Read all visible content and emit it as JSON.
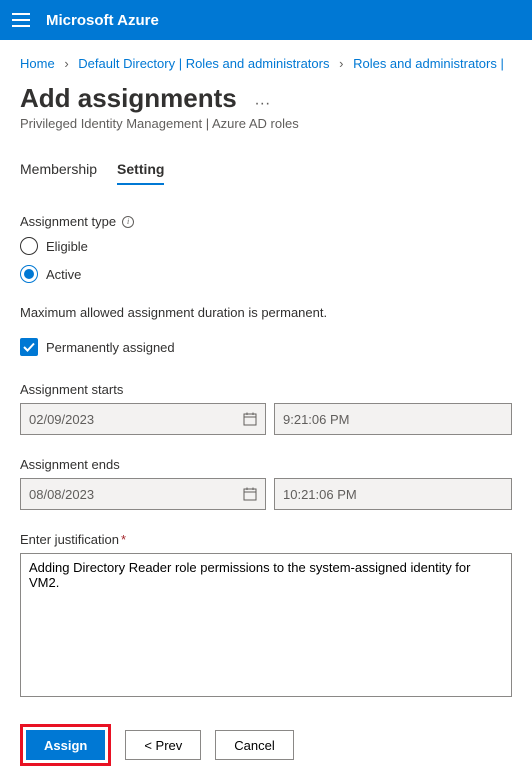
{
  "brand": "Microsoft Azure",
  "breadcrumb": {
    "home": "Home",
    "dir": "Default Directory | Roles and administrators",
    "roles": "Roles and administrators |"
  },
  "page": {
    "title": "Add assignments",
    "subtitle": "Privileged Identity Management | Azure AD roles"
  },
  "tabs": {
    "membership": "Membership",
    "setting": "Setting"
  },
  "assignment_type": {
    "label": "Assignment type",
    "eligible": "Eligible",
    "active": "Active"
  },
  "info": "Maximum allowed assignment duration is permanent.",
  "permanently_assigned": "Permanently assigned",
  "starts": {
    "label": "Assignment starts",
    "date": "02/09/2023",
    "time": "9:21:06 PM"
  },
  "ends": {
    "label": "Assignment ends",
    "date": "08/08/2023",
    "time": "10:21:06 PM"
  },
  "justification": {
    "label": "Enter justification",
    "value": "Adding Directory Reader role permissions to the system-assigned identity for VM2."
  },
  "buttons": {
    "assign": "Assign",
    "prev": "<  Prev",
    "cancel": "Cancel"
  }
}
